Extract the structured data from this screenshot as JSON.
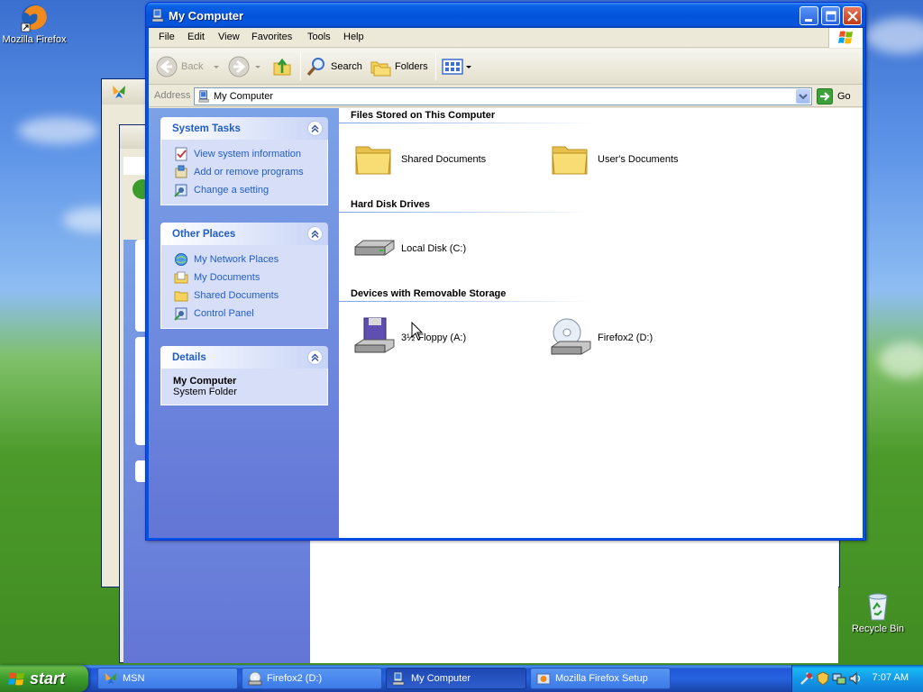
{
  "desktop": {
    "icons": [
      {
        "label": "Mozilla Firefox"
      },
      {
        "label": "Recycle Bin"
      }
    ]
  },
  "window": {
    "title": "My Computer",
    "menu": [
      "File",
      "Edit",
      "View",
      "Favorites",
      "Tools",
      "Help"
    ],
    "toolbar": {
      "back": "Back",
      "search": "Search",
      "folders": "Folders"
    },
    "address": {
      "label": "Address",
      "value": "My Computer",
      "go": "Go"
    }
  },
  "taskpane": {
    "system_tasks": {
      "title": "System Tasks",
      "links": [
        "View system information",
        "Add or remove programs",
        "Change a setting"
      ]
    },
    "other_places": {
      "title": "Other Places",
      "links": [
        "My Network Places",
        "My Documents",
        "Shared Documents",
        "Control Panel"
      ]
    },
    "details": {
      "title": "Details",
      "name": "My Computer",
      "type": "System Folder"
    }
  },
  "content": {
    "groups": [
      {
        "title": "Files Stored on This Computer",
        "items": [
          "Shared Documents",
          "User's Documents"
        ]
      },
      {
        "title": "Hard Disk Drives",
        "items": [
          "Local Disk (C:)"
        ]
      },
      {
        "title": "Devices with Removable Storage",
        "items": [
          "3½ Floppy (A:)",
          "Firefox2 (D:)"
        ]
      }
    ]
  },
  "taskbar": {
    "start": "start",
    "tasks": [
      "MSN",
      "Firefox2 (D:)",
      "My Computer",
      "Mozilla Firefox Setup"
    ],
    "clock": "7:07 AM"
  },
  "colors": {
    "title_bar": "#0553dc",
    "taskpane_link": "#215dc6",
    "start_button": "#3a9c2b",
    "tray": "#139ae9"
  }
}
